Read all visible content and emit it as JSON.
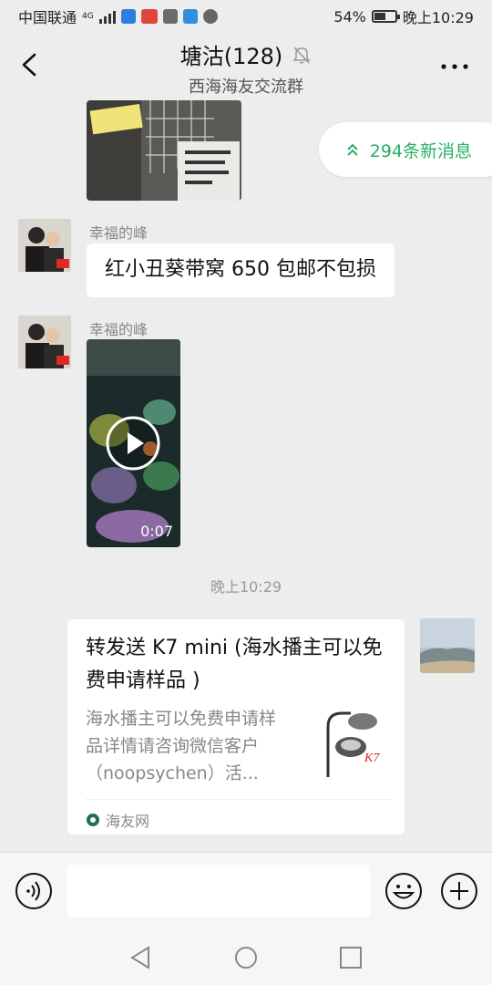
{
  "status_bar": {
    "carrier": "中国联通",
    "network": "4G",
    "battery_pct": "54%",
    "battery_level": 0.54,
    "time": "晚上10:29"
  },
  "header": {
    "title": "塘沽(128)",
    "subtitle": "西海海友交流群",
    "icons": [
      "back-icon",
      "mute-bell-icon",
      "more-icon"
    ]
  },
  "new_messages": {
    "label": "294条新消息",
    "icon": "double-chevron-up-icon"
  },
  "messages": [
    {
      "sender": "幸福的峰",
      "type": "text",
      "text": "红小丑葵带窝 650 包邮不包损"
    },
    {
      "sender": "幸福的峰",
      "type": "video",
      "duration": "0:07"
    }
  ],
  "timestamp": "晚上10:29",
  "shared_card": {
    "title": "转发送 K7 mini (海水播主可以免费申请样品 )",
    "description": "海水播主可以免费申请样品详情请咨询微信客户（noopsychen）活...",
    "source": "海友网",
    "thumb_brand": "K7"
  },
  "input_bar": {
    "placeholder": "",
    "icons": [
      "voice-icon",
      "emoji-icon",
      "plus-icon"
    ]
  },
  "navbar": {
    "icons": [
      "nav-back-icon",
      "nav-home-icon",
      "nav-recent-icon"
    ]
  },
  "colors": {
    "accent_green": "#2aae67",
    "bg": "#ededed",
    "bubble": "#ffffff"
  }
}
